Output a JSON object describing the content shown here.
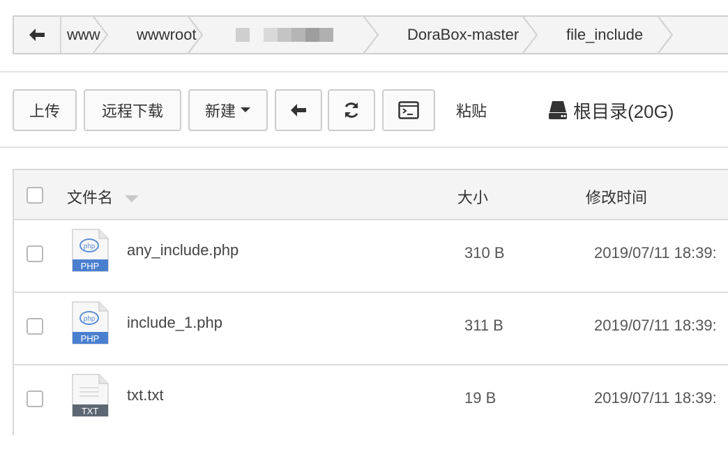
{
  "breadcrumb": {
    "items": [
      {
        "label": "www"
      },
      {
        "label": "wwwroot"
      },
      {
        "label": ""
      },
      {
        "label": "DoraBox-master"
      },
      {
        "label": "file_include"
      }
    ]
  },
  "toolbar": {
    "upload_label": "上传",
    "remote_download_label": "远程下载",
    "new_label": "新建",
    "paste_label": "粘贴",
    "disk_label": "根目录(20G)"
  },
  "table": {
    "columns": {
      "name": "文件名",
      "size": "大小",
      "modified": "修改时间"
    },
    "rows": [
      {
        "icon": "php-file-icon",
        "icon_badge": "PHP",
        "icon_glyph": "php",
        "name": "any_include.php",
        "size": "310 B",
        "modified": "2019/07/11 18:39:"
      },
      {
        "icon": "php-file-icon",
        "icon_badge": "PHP",
        "icon_glyph": "php",
        "name": "include_1.php",
        "size": "311 B",
        "modified": "2019/07/11 18:39:"
      },
      {
        "icon": "txt-file-icon",
        "icon_badge": "TXT",
        "icon_glyph": "",
        "name": "txt.txt",
        "size": "19 B",
        "modified": "2019/07/11 18:39:"
      }
    ]
  },
  "colors": {
    "php_badge": "#4a7fd0",
    "txt_badge": "#5d6773",
    "border": "#cfcfcf"
  }
}
